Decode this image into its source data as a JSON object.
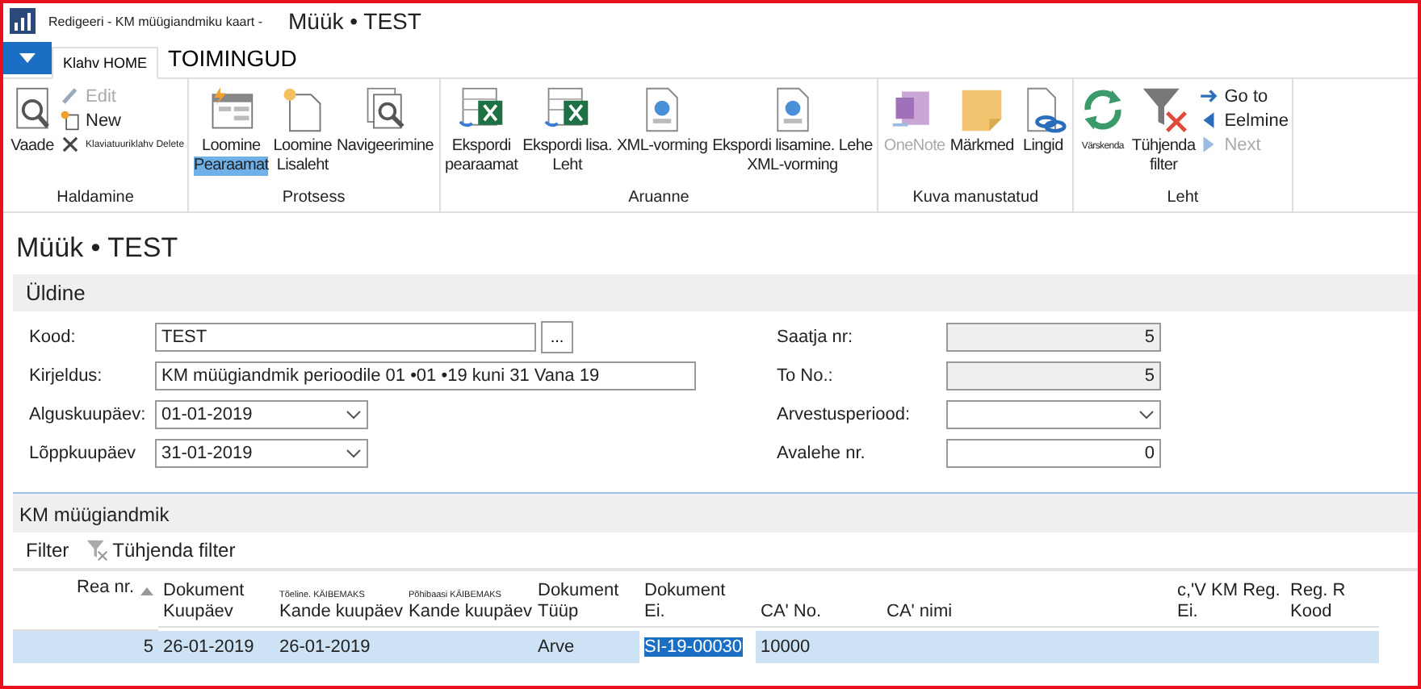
{
  "window": {
    "caption": "Redigeeri - KM müügiandmiku kaart -",
    "title": "Müük • TEST"
  },
  "tabs": [
    {
      "label": "Klahv HOME",
      "selected": true,
      "kind": "key"
    },
    {
      "label": "TOIMINGUD",
      "selected": false,
      "kind": "main"
    }
  ],
  "ribbon": {
    "groups": [
      {
        "label": "Haldamine",
        "items": [
          {
            "kind": "large",
            "lines": [
              "Vaade"
            ],
            "disabled": false
          },
          {
            "kind": "small",
            "label": "Edit",
            "disabled": true
          },
          {
            "kind": "small",
            "label": "New",
            "disabled": false
          },
          {
            "kind": "small",
            "label": "Klaviatuuriklahv Delete",
            "disabled": false
          }
        ]
      },
      {
        "label": "Protsess",
        "items": [
          {
            "kind": "large",
            "lines": [
              "Loomine",
              "Pearaamat"
            ],
            "highlight": true,
            "disabled": false
          },
          {
            "kind": "large",
            "lines": [
              "Loomine",
              "Lisaleht"
            ],
            "highlight": false,
            "disabled": false
          },
          {
            "kind": "large",
            "lines": [
              "Navigeerimine"
            ],
            "disabled": false
          }
        ]
      },
      {
        "label": "Aruanne",
        "items": [
          {
            "kind": "large",
            "lines": [
              "Ekspordi",
              "pearaamat"
            ],
            "disabled": false
          },
          {
            "kind": "large",
            "lines": [
              "Ekspordi lisa.",
              "Leht"
            ],
            "disabled": false
          },
          {
            "kind": "large",
            "lines": [
              "XML-vorming"
            ],
            "disabled": false
          },
          {
            "kind": "large",
            "lines": [
              "Ekspordi lisamine. Lehe",
              "XML-vorming"
            ],
            "disabled": false
          }
        ]
      },
      {
        "label": "Kuva manustatud",
        "items": [
          {
            "kind": "large",
            "lines": [
              "OneNote"
            ],
            "disabled": true
          },
          {
            "kind": "large",
            "lines": [
              "Märkmed"
            ],
            "disabled": false
          },
          {
            "kind": "large",
            "lines": [
              "Lingid"
            ],
            "disabled": false
          }
        ]
      },
      {
        "label": "Leht",
        "items": [
          {
            "kind": "large",
            "lines": [
              "Värskenda"
            ],
            "disabled": false
          },
          {
            "kind": "large",
            "lines": [
              "Tühjenda",
              "filter"
            ],
            "disabled": false
          },
          {
            "kind": "small",
            "label": "Go to",
            "disabled": false
          },
          {
            "kind": "small",
            "label": "Eelmine",
            "disabled": false
          },
          {
            "kind": "small",
            "label": "Next",
            "disabled": true
          }
        ]
      }
    ]
  },
  "page_title": "Müük • TEST",
  "section": {
    "title": "Üldine",
    "left_fields": [
      {
        "label": "Kood:",
        "kind": "lookup",
        "value": "TEST",
        "button": "..."
      },
      {
        "label": "Kirjeldus:",
        "kind": "wide",
        "value": "KM müügiandmik perioodile 01 •01 •19 kuni 31 Vana 19"
      },
      {
        "label": "Alguskuupäev:",
        "kind": "dropdown",
        "value": "01-01-2019"
      },
      {
        "label": "Lõppkuupäev",
        "kind": "dropdown",
        "value": "31-01-2019"
      }
    ],
    "right_fields": [
      {
        "label": "Saatja nr:",
        "kind": "readonly",
        "value": "5"
      },
      {
        "label": "To No.:",
        "kind": "readonly",
        "value": "5"
      },
      {
        "label": "Arvestusperiood:",
        "kind": "dropdown"
      },
      {
        "label": "Avalehe nr.",
        "kind": "number",
        "value": "0"
      }
    ]
  },
  "subpage": {
    "title": "KM müügiandmik",
    "actions": [
      {
        "label": "Filter",
        "kind": "text"
      },
      {
        "label": "Tühjenda filter",
        "kind": "clear"
      }
    ],
    "columns": [
      {
        "lines": [
          "Rea nr."
        ],
        "sorted": true
      },
      {
        "lines": [
          "Dokument",
          "Kuupäev"
        ],
        "sorted": false
      },
      {
        "top": "Tõeline. KÄIBEMAKS",
        "lines": [
          "Kande kuupäev"
        ],
        "sorted": false
      },
      {
        "top": "Põhibaasi KÄIBEMAKS",
        "lines": [
          "Kande kuupäev"
        ],
        "sorted": false
      },
      {
        "lines": [
          "Dokument",
          "Tüüp"
        ],
        "sorted": false
      },
      {
        "lines": [
          "Dokument",
          "Ei."
        ],
        "sorted": false
      },
      {
        "lines": [
          "CA' No."
        ],
        "sorted": false
      },
      {
        "lines": [
          "CA' nimi"
        ],
        "sorted": false
      },
      {
        "lines": [
          "c,'V KM Reg.",
          "Ei."
        ],
        "sorted": false
      },
      {
        "lines": [
          "Reg. R",
          "Kood"
        ],
        "sorted": false
      }
    ],
    "rows": [
      {
        "selected": true,
        "cells": [
          {
            "text": "5",
            "selected": false
          },
          {
            "text": "26-01-2019",
            "selected": false
          },
          {
            "text": "26-01-2019",
            "selected": false
          },
          {
            "selected": false
          },
          {
            "text": "Arve",
            "selected": false
          },
          {
            "text": "SI-19-00030",
            "selected": true
          },
          {
            "text": "10000",
            "selected": false
          },
          {
            "selected": false
          },
          {
            "selected": false
          },
          {
            "selected": false
          }
        ]
      }
    ]
  }
}
